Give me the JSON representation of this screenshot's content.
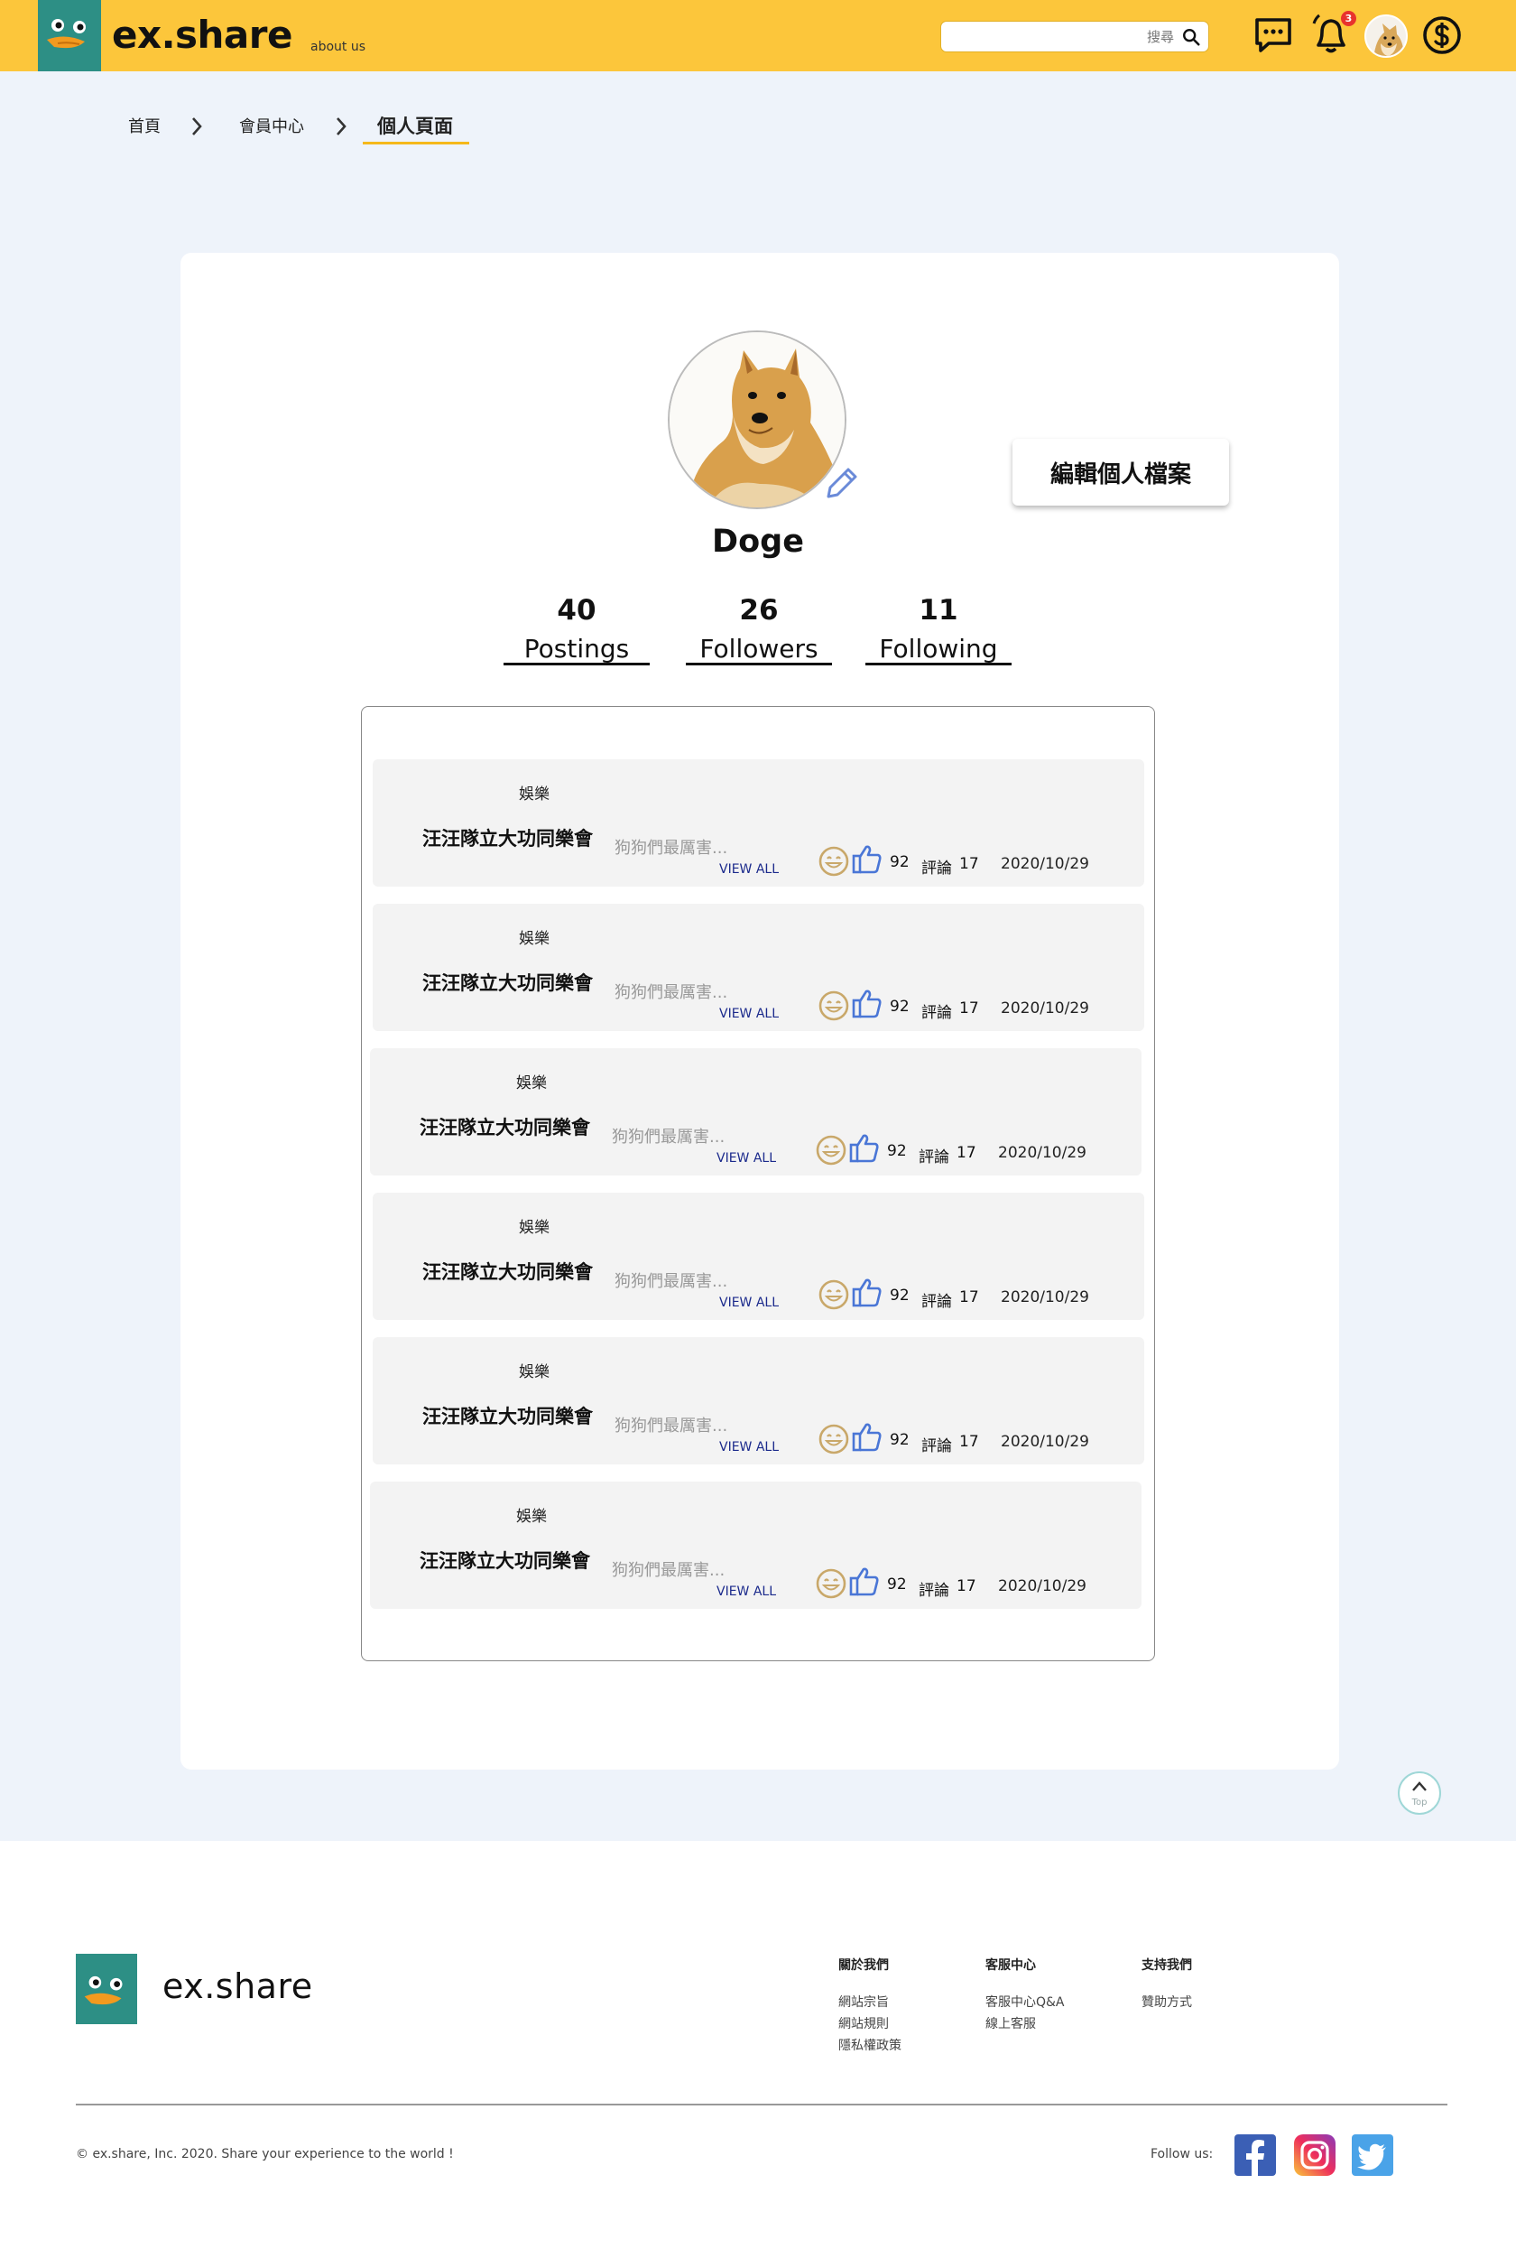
{
  "header": {
    "brand": "ex.share",
    "about_label": "about us",
    "search_placeholder": "搜尋",
    "notification_count": "3",
    "icons": [
      "chat-icon",
      "bell-icon",
      "avatar",
      "dollar-icon"
    ],
    "colors": {
      "bar": "#fcc63b",
      "logo_bg": "#2d8f85"
    }
  },
  "breadcrumb": {
    "items": [
      "首頁",
      "會員中心",
      "個人頁面"
    ]
  },
  "profile": {
    "name": "Doge",
    "edit_label": "編輯個人檔案",
    "stats": [
      {
        "value": "40",
        "label": "Postings"
      },
      {
        "value": "26",
        "label": "Followers"
      },
      {
        "value": "11",
        "label": "Following"
      }
    ]
  },
  "posts": [
    {
      "category": "娛樂",
      "title": "汪汪隊立大功同樂會",
      "excerpt": "狗狗們最厲害...",
      "view_all": "VIEW ALL",
      "likes": "92",
      "comment_label": "評論",
      "comments": "17",
      "date": "2020/10/29"
    },
    {
      "category": "娛樂",
      "title": "汪汪隊立大功同樂會",
      "excerpt": "狗狗們最厲害...",
      "view_all": "VIEW ALL",
      "likes": "92",
      "comment_label": "評論",
      "comments": "17",
      "date": "2020/10/29"
    },
    {
      "category": "娛樂",
      "title": "汪汪隊立大功同樂會",
      "excerpt": "狗狗們最厲害...",
      "view_all": "VIEW ALL",
      "likes": "92",
      "comment_label": "評論",
      "comments": "17",
      "date": "2020/10/29"
    },
    {
      "category": "娛樂",
      "title": "汪汪隊立大功同樂會",
      "excerpt": "狗狗們最厲害...",
      "view_all": "VIEW ALL",
      "likes": "92",
      "comment_label": "評論",
      "comments": "17",
      "date": "2020/10/29"
    },
    {
      "category": "娛樂",
      "title": "汪汪隊立大功同樂會",
      "excerpt": "狗狗們最厲害...",
      "view_all": "VIEW ALL",
      "likes": "92",
      "comment_label": "評論",
      "comments": "17",
      "date": "2020/10/29"
    },
    {
      "category": "娛樂",
      "title": "汪汪隊立大功同樂會",
      "excerpt": "狗狗們最厲害...",
      "view_all": "VIEW ALL",
      "likes": "92",
      "comment_label": "評論",
      "comments": "17",
      "date": "2020/10/29"
    }
  ],
  "top_button": {
    "label": "Top"
  },
  "footer": {
    "brand": "ex.share",
    "columns": [
      {
        "heading": "關於我們",
        "links": [
          "網站宗旨",
          "網站規則",
          "隱私權政策"
        ]
      },
      {
        "heading": "客服中心",
        "links": [
          "客服中心Q&A",
          "線上客服"
        ]
      },
      {
        "heading": "支持我們",
        "links": [
          "贊助方式"
        ]
      }
    ],
    "copyright": "© ex.share, Inc. 2020. Share your experience to the world !",
    "follow_label": "Follow us:",
    "social": [
      "facebook-icon",
      "instagram-icon",
      "twitter-icon"
    ]
  }
}
